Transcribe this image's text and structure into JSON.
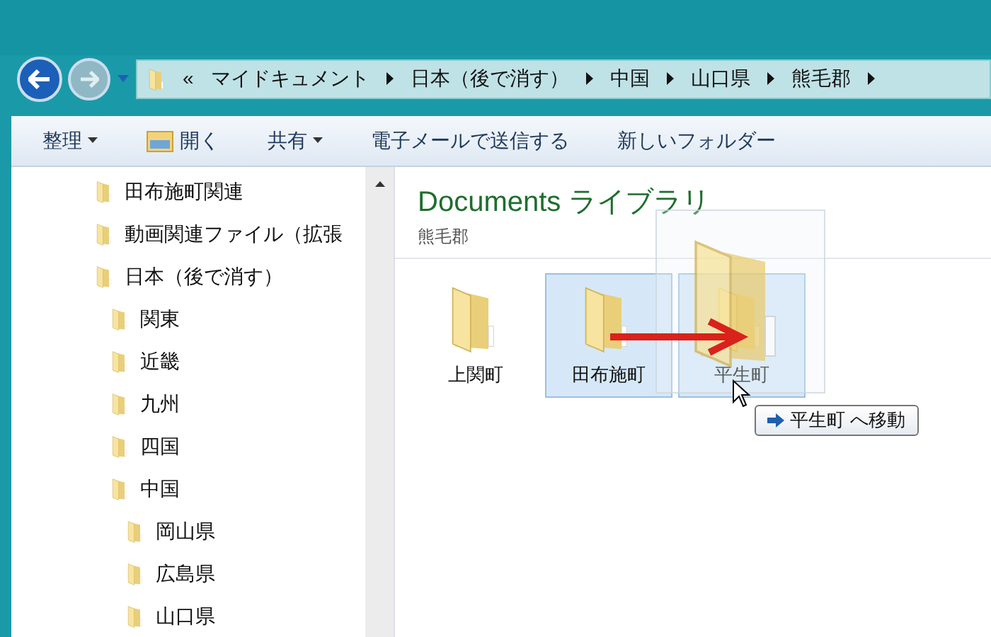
{
  "breadcrumb": {
    "overflow": "«",
    "items": [
      "マイドキュメント",
      "日本（後で消す）",
      "中国",
      "山口県",
      "熊毛郡"
    ]
  },
  "toolbar": [
    {
      "label": "整理",
      "kind": "menu"
    },
    {
      "label": "開く",
      "kind": "icon"
    },
    {
      "label": "共有",
      "kind": "menu"
    },
    {
      "label": "電子メールで送信する",
      "kind": "plain"
    },
    {
      "label": "新しいフォルダー",
      "kind": "plain"
    }
  ],
  "nav_tree": [
    {
      "label": "田布施町関連"
    },
    {
      "label": "動画関連ファイル（拡張"
    },
    {
      "label": "日本（後で消す）",
      "children": [
        {
          "label": "関東"
        },
        {
          "label": "近畿"
        },
        {
          "label": "九州"
        },
        {
          "label": "四国"
        },
        {
          "label": "中国",
          "children": [
            {
              "label": "岡山県"
            },
            {
              "label": "広島県"
            },
            {
              "label": "山口県"
            }
          ]
        }
      ]
    }
  ],
  "content": {
    "title": "Documents ライブラリ",
    "subtitle": "熊毛郡",
    "items": [
      {
        "label": "上関町",
        "selected": false
      },
      {
        "label": "田布施町",
        "selected": true
      },
      {
        "label": "平生町",
        "selected": true
      }
    ]
  },
  "drag_tooltip": "平生町 へ移動"
}
